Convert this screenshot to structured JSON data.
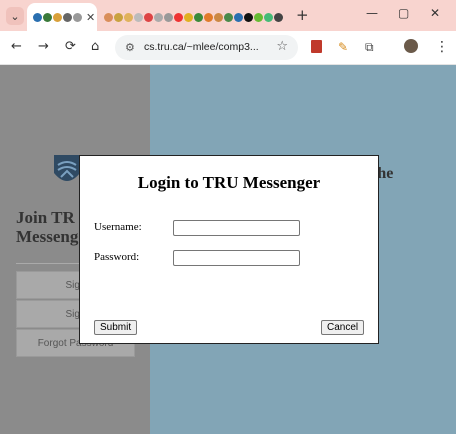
{
  "browser": {
    "tabs": [
      {
        "label": "",
        "active": true
      },
      {
        "label": "",
        "active": false
      }
    ],
    "new_tab": "+",
    "window_controls": {
      "minimize": "—",
      "maximize": "▢",
      "close": "✕"
    },
    "url": "cs.tru.ca/~mlee/comp3...",
    "nav": {
      "back": "←",
      "forward": "→",
      "reload": "⟳",
      "home": "⌂"
    },
    "star": "☆",
    "menu": "⋮"
  },
  "page": {
    "left_heading_line1": "Join TR",
    "left_heading_line2": "Messeng",
    "side_buttons": [
      {
        "label": "Sign"
      },
      {
        "label": "Sign"
      },
      {
        "label": "Forgot Password"
      }
    ],
    "right_fragment": "the"
  },
  "modal": {
    "title": "Login to TRU Messenger",
    "username_label": "Username:",
    "username_value": "",
    "password_label": "Password:",
    "password_value": "",
    "submit_label": "Submit",
    "cancel_label": "Cancel"
  },
  "colors": {
    "tab_strip": "#f8d4cf",
    "left_panel": "#8b8b8b",
    "right_panel": "#82a5b6",
    "modal_bg": "#ffffff"
  }
}
